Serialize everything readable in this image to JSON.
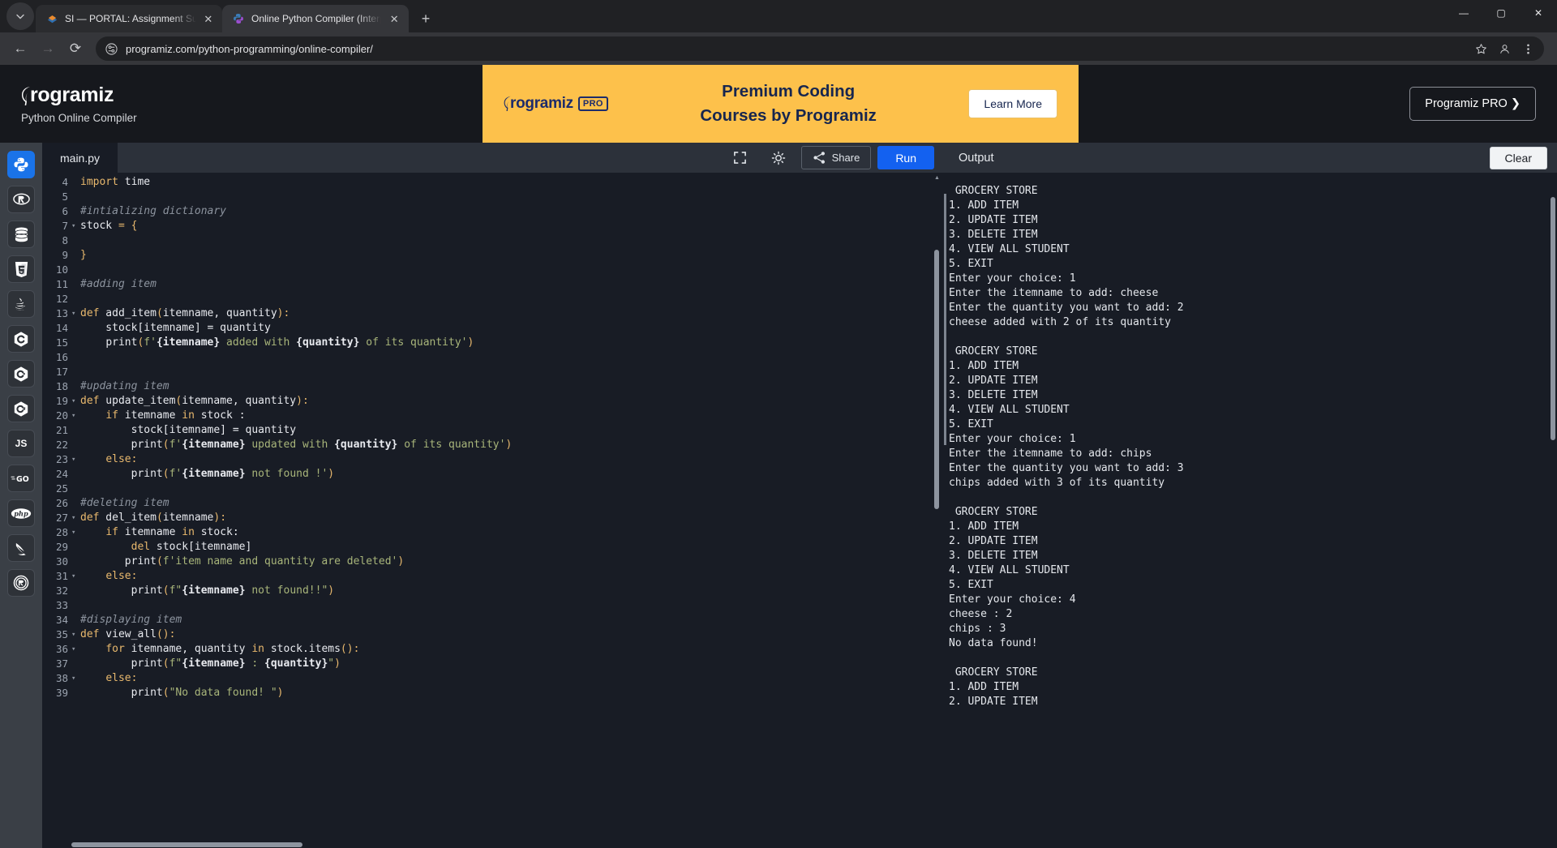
{
  "browser": {
    "tabs": [
      {
        "title": "SI — PORTAL: Assignment Subm",
        "favicon": "sakai-icon",
        "active": false
      },
      {
        "title": "Online Python Compiler (Interp",
        "favicon": "python-icon",
        "active": true
      }
    ],
    "new_tab_label": "+",
    "tab_close_label": "✕",
    "window_controls": {
      "minimize": "—",
      "maximize": "▢",
      "close": "✕"
    },
    "nav": {
      "back": "←",
      "forward": "→",
      "reload": "⟳"
    },
    "url": "programiz.com/python-programming/online-compiler/",
    "omnibox_icons": [
      "site-settings-icon",
      "bookmark-star-icon",
      "profile-icon",
      "chrome-menu-icon"
    ]
  },
  "site": {
    "logo_text": "rogramiz",
    "subtitle": "Python Online Compiler",
    "pro_cta": "Programiz PRO ❯"
  },
  "promo": {
    "logo_text": "rogramiz",
    "pro_badge": "PRO",
    "line1": "Premium Coding",
    "line2": "Courses by Programiz",
    "button": "Learn More"
  },
  "languages": [
    {
      "name": "python",
      "label": "",
      "active": true
    },
    {
      "name": "r",
      "label": "",
      "active": false
    },
    {
      "name": "sql",
      "label": "",
      "active": false
    },
    {
      "name": "html",
      "label": "",
      "active": false
    },
    {
      "name": "java",
      "label": "",
      "active": false
    },
    {
      "name": "c",
      "label": "",
      "active": false
    },
    {
      "name": "cpp",
      "label": "",
      "active": false
    },
    {
      "name": "csharp",
      "label": "",
      "active": false
    },
    {
      "name": "javascript",
      "label": "JS",
      "active": false
    },
    {
      "name": "go",
      "label": "GO",
      "active": false
    },
    {
      "name": "php",
      "label": "php",
      "active": false
    },
    {
      "name": "swift",
      "label": "",
      "active": false
    },
    {
      "name": "rust",
      "label": "",
      "active": false
    }
  ],
  "editor": {
    "filename": "main.py",
    "actions": {
      "fullscreen": "fullscreen-icon",
      "theme": "brightness-icon",
      "share": "Share",
      "run": "Run"
    },
    "first_visible_line": 4,
    "lines": [
      {
        "n": 4,
        "fold": false,
        "tokens": [
          [
            "k",
            "import"
          ],
          [
            "t",
            " "
          ],
          [
            "t",
            "time"
          ]
        ]
      },
      {
        "n": 5,
        "fold": false,
        "tokens": []
      },
      {
        "n": 6,
        "fold": false,
        "tokens": [
          [
            "cm",
            "#intializing dictionary"
          ]
        ]
      },
      {
        "n": 7,
        "fold": true,
        "tokens": [
          [
            "t",
            "stock "
          ],
          [
            "pn",
            "= {"
          ]
        ]
      },
      {
        "n": 8,
        "fold": false,
        "tokens": []
      },
      {
        "n": 9,
        "fold": false,
        "tokens": [
          [
            "pn",
            "}"
          ]
        ]
      },
      {
        "n": 10,
        "fold": false,
        "tokens": []
      },
      {
        "n": 11,
        "fold": false,
        "tokens": [
          [
            "cm",
            "#adding item"
          ]
        ]
      },
      {
        "n": 12,
        "fold": false,
        "tokens": []
      },
      {
        "n": 13,
        "fold": true,
        "tokens": [
          [
            "k",
            "def"
          ],
          [
            "t",
            " add_item"
          ],
          [
            "pn",
            "("
          ],
          [
            "t",
            "itemname, quantity"
          ],
          [
            "pn",
            ")"
          ],
          [
            "pn",
            ":"
          ]
        ]
      },
      {
        "n": 14,
        "fold": false,
        "tokens": [
          [
            "t",
            "    stock[itemname] = quantity"
          ]
        ]
      },
      {
        "n": 15,
        "fold": false,
        "tokens": [
          [
            "t",
            "    "
          ],
          [
            "t",
            "print"
          ],
          [
            "pn",
            "("
          ],
          [
            "str",
            "f'"
          ],
          [
            "br",
            "{itemname}"
          ],
          [
            "str",
            " added with "
          ],
          [
            "br",
            "{quantity}"
          ],
          [
            "str",
            " of its quantity'"
          ],
          [
            "pn",
            ")"
          ]
        ]
      },
      {
        "n": 16,
        "fold": false,
        "tokens": []
      },
      {
        "n": 17,
        "fold": false,
        "tokens": []
      },
      {
        "n": 18,
        "fold": false,
        "tokens": [
          [
            "cm",
            "#updating item"
          ]
        ]
      },
      {
        "n": 19,
        "fold": true,
        "tokens": [
          [
            "k",
            "def"
          ],
          [
            "t",
            " update_item"
          ],
          [
            "pn",
            "("
          ],
          [
            "t",
            "itemname, quantity"
          ],
          [
            "pn",
            ")"
          ],
          [
            "pn",
            ":"
          ]
        ]
      },
      {
        "n": 20,
        "fold": true,
        "tokens": [
          [
            "t",
            "    "
          ],
          [
            "k",
            "if"
          ],
          [
            "t",
            " itemname "
          ],
          [
            "k",
            "in"
          ],
          [
            "t",
            " stock :"
          ]
        ]
      },
      {
        "n": 21,
        "fold": false,
        "tokens": [
          [
            "t",
            "        stock[itemname] = quantity"
          ]
        ]
      },
      {
        "n": 22,
        "fold": false,
        "tokens": [
          [
            "t",
            "        "
          ],
          [
            "t",
            "print"
          ],
          [
            "pn",
            "("
          ],
          [
            "str",
            "f'"
          ],
          [
            "br",
            "{itemname}"
          ],
          [
            "str",
            " updated with "
          ],
          [
            "br",
            "{quantity}"
          ],
          [
            "str",
            " of its quantity'"
          ],
          [
            "pn",
            ")"
          ]
        ]
      },
      {
        "n": 23,
        "fold": true,
        "tokens": [
          [
            "t",
            "    "
          ],
          [
            "k",
            "else"
          ],
          [
            "pn",
            ":"
          ]
        ]
      },
      {
        "n": 24,
        "fold": false,
        "tokens": [
          [
            "t",
            "        "
          ],
          [
            "t",
            "print"
          ],
          [
            "pn",
            "("
          ],
          [
            "str",
            "f'"
          ],
          [
            "br",
            "{itemname}"
          ],
          [
            "str",
            " not found !'"
          ],
          [
            "pn",
            ")"
          ]
        ]
      },
      {
        "n": 25,
        "fold": false,
        "tokens": []
      },
      {
        "n": 26,
        "fold": false,
        "tokens": [
          [
            "cm",
            "#deleting item"
          ]
        ]
      },
      {
        "n": 27,
        "fold": true,
        "tokens": [
          [
            "k",
            "def"
          ],
          [
            "t",
            " del_item"
          ],
          [
            "pn",
            "("
          ],
          [
            "t",
            "itemname"
          ],
          [
            "pn",
            ")"
          ],
          [
            "pn",
            ":"
          ]
        ]
      },
      {
        "n": 28,
        "fold": true,
        "tokens": [
          [
            "t",
            "    "
          ],
          [
            "k",
            "if"
          ],
          [
            "t",
            " itemname "
          ],
          [
            "k",
            "in"
          ],
          [
            "t",
            " stock:"
          ]
        ]
      },
      {
        "n": 29,
        "fold": false,
        "tokens": [
          [
            "t",
            "        "
          ],
          [
            "k",
            "del"
          ],
          [
            "t",
            " stock[itemname]"
          ]
        ]
      },
      {
        "n": 30,
        "fold": false,
        "tokens": [
          [
            "t",
            "       "
          ],
          [
            "t",
            "print"
          ],
          [
            "pn",
            "("
          ],
          [
            "str",
            "f'item name and quantity are deleted'"
          ],
          [
            "pn",
            ")"
          ]
        ]
      },
      {
        "n": 31,
        "fold": true,
        "tokens": [
          [
            "t",
            "    "
          ],
          [
            "k",
            "else"
          ],
          [
            "pn",
            ":"
          ]
        ]
      },
      {
        "n": 32,
        "fold": false,
        "tokens": [
          [
            "t",
            "        "
          ],
          [
            "t",
            "print"
          ],
          [
            "pn",
            "("
          ],
          [
            "str",
            "f\""
          ],
          [
            "br",
            "{itemname}"
          ],
          [
            "str",
            " not found!!\""
          ],
          [
            "pn",
            ")"
          ]
        ]
      },
      {
        "n": 33,
        "fold": false,
        "tokens": []
      },
      {
        "n": 34,
        "fold": false,
        "tokens": [
          [
            "cm",
            "#displaying item"
          ]
        ]
      },
      {
        "n": 35,
        "fold": true,
        "tokens": [
          [
            "k",
            "def"
          ],
          [
            "t",
            " view_all"
          ],
          [
            "pn",
            "("
          ],
          [
            "pn",
            ")"
          ],
          [
            "pn",
            ":"
          ]
        ]
      },
      {
        "n": 36,
        "fold": true,
        "tokens": [
          [
            "t",
            "    "
          ],
          [
            "k",
            "for"
          ],
          [
            "t",
            " itemname, quantity "
          ],
          [
            "k",
            "in"
          ],
          [
            "t",
            " stock.items"
          ],
          [
            "pn",
            "("
          ],
          [
            "pn",
            "):"
          ]
        ]
      },
      {
        "n": 37,
        "fold": false,
        "tokens": [
          [
            "t",
            "        "
          ],
          [
            "t",
            "print"
          ],
          [
            "pn",
            "("
          ],
          [
            "str",
            "f\""
          ],
          [
            "br",
            "{itemname}"
          ],
          [
            "str",
            " : "
          ],
          [
            "br",
            "{quantity}"
          ],
          [
            "str",
            "\""
          ],
          [
            "pn",
            ")"
          ]
        ]
      },
      {
        "n": 38,
        "fold": true,
        "tokens": [
          [
            "t",
            "    "
          ],
          [
            "k",
            "else"
          ],
          [
            "pn",
            ":"
          ]
        ]
      },
      {
        "n": 39,
        "fold": false,
        "tokens": [
          [
            "t",
            "        "
          ],
          [
            "t",
            "print"
          ],
          [
            "pn",
            "("
          ],
          [
            "str",
            "\"No data found! \""
          ],
          [
            "pn",
            ")"
          ]
        ]
      }
    ]
  },
  "output": {
    "title": "Output",
    "clear_label": "Clear",
    "text": " GROCERY STORE\n1. ADD ITEM\n2. UPDATE ITEM\n3. DELETE ITEM\n4. VIEW ALL STUDENT\n5. EXIT\nEnter your choice: 1\nEnter the itemname to add: cheese\nEnter the quantity you want to add: 2\ncheese added with 2 of its quantity\n\n GROCERY STORE\n1. ADD ITEM\n2. UPDATE ITEM\n3. DELETE ITEM\n4. VIEW ALL STUDENT\n5. EXIT\nEnter your choice: 1\nEnter the itemname to add: chips\nEnter the quantity you want to add: 3\nchips added with 3 of its quantity\n\n GROCERY STORE\n1. ADD ITEM\n2. UPDATE ITEM\n3. DELETE ITEM\n4. VIEW ALL STUDENT\n5. EXIT\nEnter your choice: 4\ncheese : 2\nchips : 3\nNo data found!\n\n GROCERY STORE\n1. ADD ITEM\n2. UPDATE ITEM"
  },
  "colors": {
    "accent_blue": "#1361f0",
    "promo_yellow": "#fdc14b",
    "promo_navy": "#17264f",
    "editor_bg": "#181c25",
    "panel_bg": "#2c313a"
  }
}
